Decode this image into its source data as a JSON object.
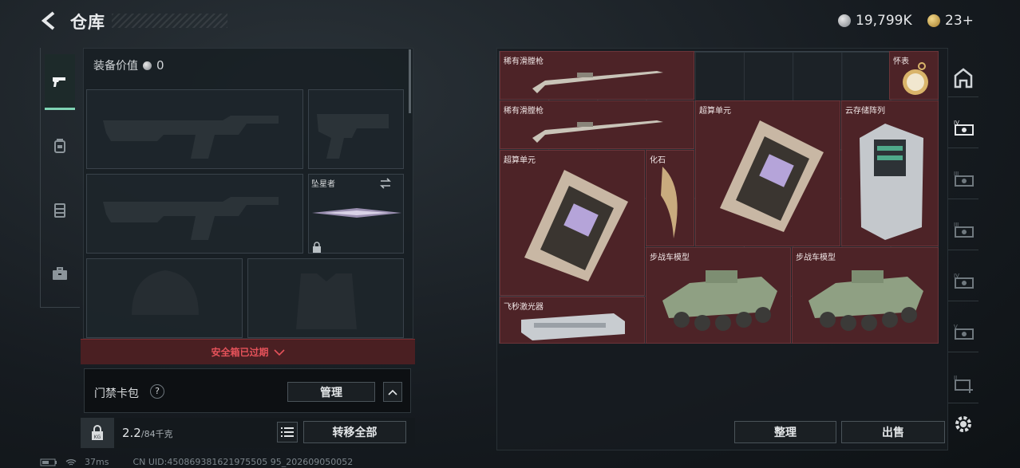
{
  "header": {
    "title": "仓库",
    "currencies": [
      {
        "type": "silver",
        "value": "19,799K"
      },
      {
        "type": "gold",
        "value": "23+"
      }
    ]
  },
  "categories": [
    {
      "icon": "pistol-icon",
      "active": true
    },
    {
      "icon": "backpack-icon",
      "active": false
    },
    {
      "icon": "vest-icon",
      "active": false
    },
    {
      "icon": "briefcase-icon",
      "active": false
    }
  ],
  "equipment": {
    "value_label": "装备价值",
    "value": "0",
    "melee_label": "坠星者"
  },
  "safe_box": {
    "status": "安全箱已过期"
  },
  "card_pack": {
    "label": "门禁卡包",
    "help": "?",
    "manage_label": "管理"
  },
  "weight": {
    "current": "2.2",
    "max": "/84千克",
    "lock_icon_text": "KG",
    "transfer_all_label": "转移全部"
  },
  "stash": {
    "items": [
      {
        "name": "稀有滑膛枪",
        "icon": "musket"
      },
      {
        "name": "怀表",
        "icon": "pocket-watch"
      },
      {
        "name": "稀有滑膛枪",
        "icon": "musket"
      },
      {
        "name": "超算单元",
        "icon": "compute-unit"
      },
      {
        "name": "云存储阵列",
        "icon": "storage-array"
      },
      {
        "name": "超算单元",
        "icon": "compute-unit"
      },
      {
        "name": "化石",
        "icon": "fossil-claw"
      },
      {
        "name": "步战车模型",
        "icon": "ifv-model"
      },
      {
        "name": "步战车模型",
        "icon": "ifv-model"
      },
      {
        "name": "飞秒激光器",
        "icon": "laser-device"
      }
    ],
    "sort_label": "整理",
    "sell_label": "出售"
  },
  "side_tabs": [
    {
      "icon": "home-storage-icon"
    },
    {
      "icon": "tier-4-storage-icon"
    },
    {
      "icon": "tier-3-storage-icon"
    },
    {
      "icon": "tier-3b-storage-icon"
    },
    {
      "icon": "tier-4b-storage-icon"
    },
    {
      "icon": "tier-5-storage-icon"
    },
    {
      "icon": "tier-2-add-icon"
    }
  ],
  "status_bar": {
    "ping": "37ms",
    "uid": "CN UID:450869381621975505 95_202609050052"
  }
}
